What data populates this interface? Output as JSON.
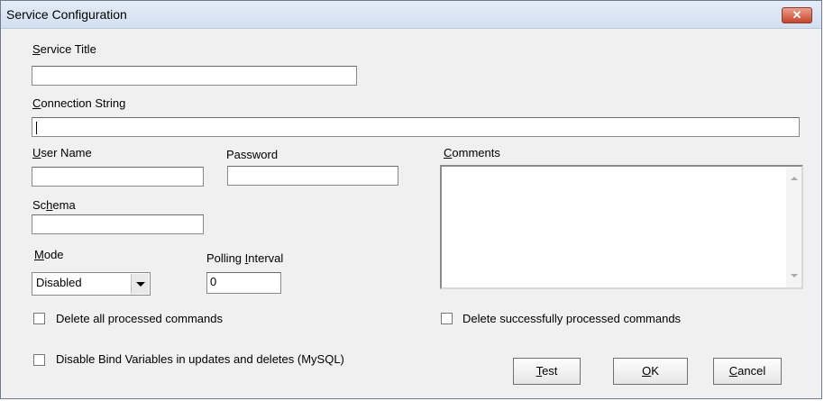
{
  "window": {
    "title": "Service Configuration",
    "close_glyph": "✕"
  },
  "service_title": {
    "label": "Service Title",
    "value": ""
  },
  "connection_string": {
    "label": "Connection String",
    "value": ""
  },
  "user_name": {
    "label": "User Name",
    "value": ""
  },
  "password": {
    "label": "Password",
    "value": ""
  },
  "comments": {
    "label": "Comments",
    "value": ""
  },
  "schema": {
    "label": "Schema",
    "value": ""
  },
  "mode": {
    "label": "Mode",
    "value": "Disabled"
  },
  "polling_interval": {
    "label": "Polling Interval",
    "value": "0"
  },
  "checkboxes": {
    "delete_all": "Delete all processed commands",
    "delete_success": "Delete successfully processed commands",
    "disable_bind": "Disable Bind Variables in updates and deletes (MySQL)"
  },
  "buttons": {
    "test": "Test",
    "ok": "OK",
    "cancel": "Cancel"
  }
}
